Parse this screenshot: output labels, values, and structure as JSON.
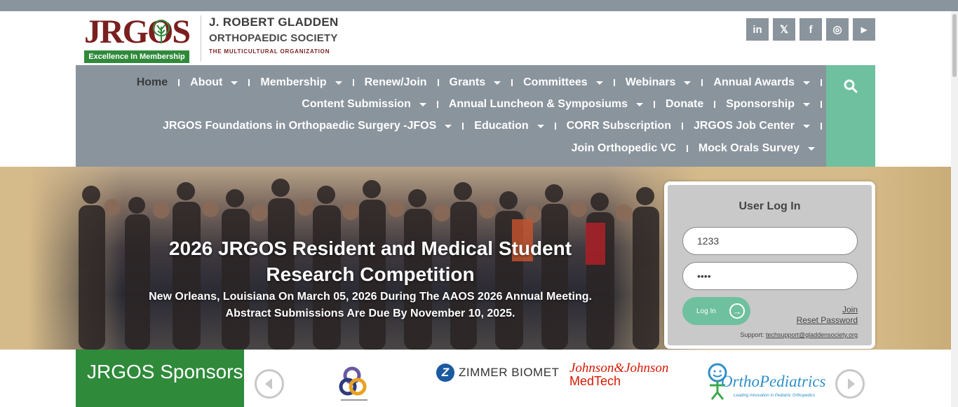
{
  "header": {
    "logo_text": "JRGOS",
    "logo_badge": "Excellence In Membership",
    "society_line1": "J. ROBERT GLADDEN",
    "society_line2": "ORTHOPAEDIC SOCIETY",
    "society_line3": "THE MULTICULTURAL ORGANIZATION",
    "social": [
      {
        "name": "linkedin-icon",
        "glyph": "in"
      },
      {
        "name": "x-twitter-icon",
        "glyph": "𝕏"
      },
      {
        "name": "facebook-icon",
        "glyph": "f"
      },
      {
        "name": "instagram-icon",
        "glyph": "◎"
      },
      {
        "name": "youtube-icon",
        "glyph": "▶"
      }
    ]
  },
  "nav": {
    "home": "Home",
    "about": "About",
    "membership": "Membership",
    "renew_join": "Renew/Join",
    "grants": "Grants",
    "committees": "Committees",
    "webinars": "Webinars",
    "annual_awards": "Annual Awards",
    "content_submission": "Content Submission",
    "annual_luncheon": "Annual Luncheon & Symposiums",
    "donate": "Donate",
    "sponsorship": "Sponsorship",
    "jfos": "JRGOS Foundations in Orthopaedic Surgery -JFOS",
    "education": "Education",
    "corr": "CORR Subscription",
    "job_center": "JRGOS Job Center",
    "join_vc": "Join Orthopedic VC",
    "mock_orals": "Mock Orals Survey"
  },
  "hero": {
    "title": "2026 JRGOS Resident and Medical Student Research Competition",
    "line1": "New Orleans, Louisiana On March 05, 2026 During The AAOS 2026 Annual Meeting.",
    "line2": "Abstract Submissions Are Due By November 10, 2025."
  },
  "login": {
    "title": "User Log In",
    "username_value": "1233",
    "password_value": "••••",
    "button": "Log In",
    "join": "Join",
    "reset": "Reset Password",
    "support_label": "Support:",
    "support_email": "techsupport@gladdensociety.org"
  },
  "sponsors": {
    "heading": "JRGOS Sponsors",
    "zimmer": "ZIMMER BIOMET",
    "zimmer_mark": "Z",
    "jj_line1": "Johnson&Johnson",
    "jj_line2": "MedTech",
    "ortho": "OrthoPediatrics",
    "ortho_tag": "Leading Innovation in Pediatric Orthopedics"
  },
  "colors": {
    "nav_bg": "#8a949d",
    "accent_green": "#6fc09f",
    "brand_green": "#2f8a3a",
    "brand_maroon": "#7a1f1f"
  }
}
